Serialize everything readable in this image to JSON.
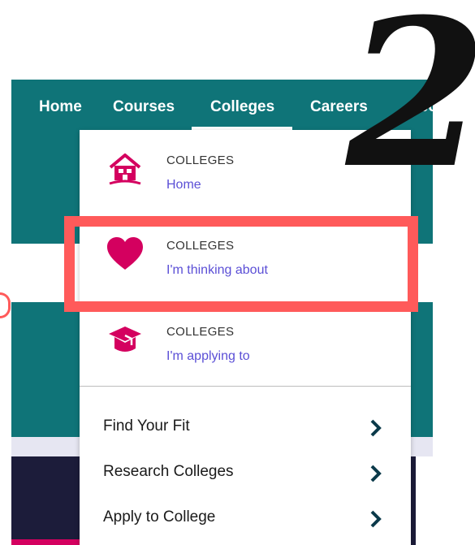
{
  "nav": {
    "items": [
      "Home",
      "Courses",
      "Colleges",
      "Careers",
      "Abou"
    ],
    "active": "Colleges"
  },
  "annotation": {
    "step_number": "2",
    "highlight_color": "#ff5a5a"
  },
  "dropdown": {
    "items": [
      {
        "eyebrow": "COLLEGES",
        "link": "Home",
        "icon": "house-icon"
      },
      {
        "eyebrow": "COLLEGES",
        "link": "I'm thinking about",
        "icon": "heart-icon"
      },
      {
        "eyebrow": "COLLEGES",
        "link": "I'm applying to",
        "icon": "graduation-cap-icon"
      }
    ],
    "menu": [
      {
        "label": "Find Your Fit"
      },
      {
        "label": "Research Colleges"
      },
      {
        "label": "Apply to College"
      }
    ]
  },
  "colors": {
    "teal": "#0f7478",
    "accent_pink": "#d4005f",
    "link_purple": "#5b4fd6"
  }
}
